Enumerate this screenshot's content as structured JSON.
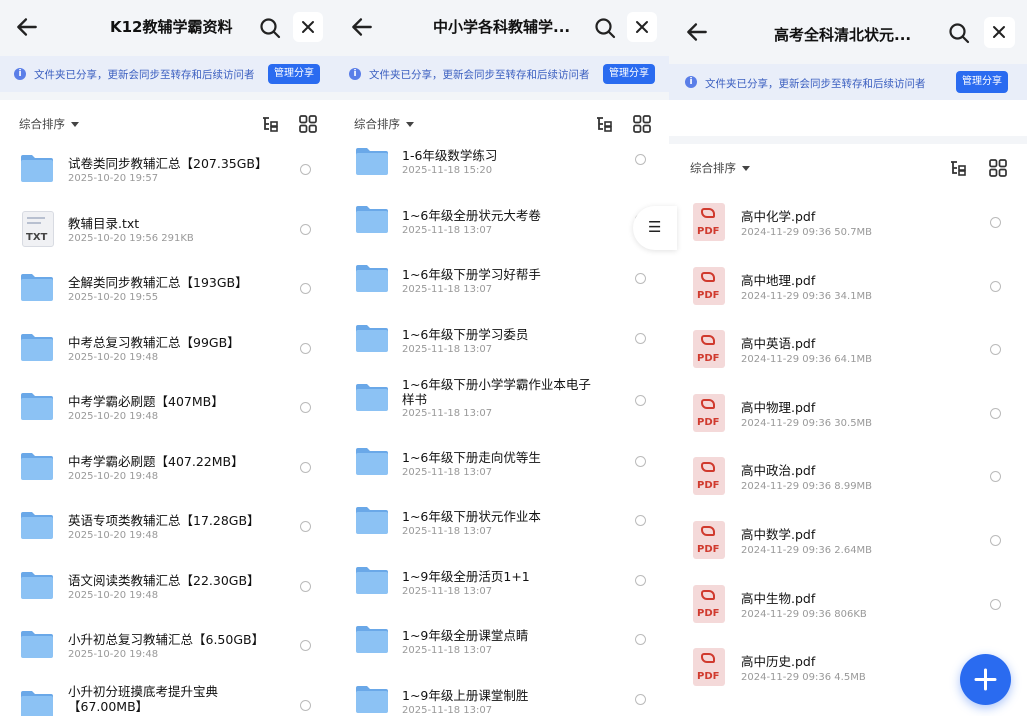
{
  "panel1": {
    "title": "K12教辅学霸资料",
    "banner_text": "文件夹已分享，更新会同步至转存和后续访问者",
    "manage_label": "管理分享",
    "sort_label": "综合排序",
    "items": [
      {
        "type": "folder",
        "name": "试卷类同步教辅汇总【207.35GB】",
        "meta": "2025-10-20 19:57"
      },
      {
        "type": "txt",
        "name": "教辅目录.txt",
        "meta": "2025-10-20 19:56  291KB",
        "icon_label": "TXT"
      },
      {
        "type": "folder",
        "name": "全解类同步教辅汇总【193GB】",
        "meta": "2025-10-20 19:55"
      },
      {
        "type": "folder",
        "name": "中考总复习教辅汇总【99GB】",
        "meta": "2025-10-20 19:48"
      },
      {
        "type": "folder",
        "name": "中考学霸必刷题【407MB】",
        "meta": "2025-10-20 19:48"
      },
      {
        "type": "folder",
        "name": "中考学霸必刷题【407.22MB】",
        "meta": "2025-10-20 19:48"
      },
      {
        "type": "folder",
        "name": "英语专项类教辅汇总【17.28GB】",
        "meta": "2025-10-20 19:48"
      },
      {
        "type": "folder",
        "name": "语文阅读类教辅汇总【22.30GB】",
        "meta": "2025-10-20 19:48"
      },
      {
        "type": "folder",
        "name": "小升初总复习教辅汇总【6.50GB】",
        "meta": "2025-10-20 19:48"
      },
      {
        "type": "folder",
        "name": "小升初分班摸底考提升宝典【67.00MB】",
        "meta": ""
      }
    ]
  },
  "panel2": {
    "title": "中小学各科教辅学...",
    "banner_text": "文件夹已分享，更新会同步至转存和后续访问者",
    "manage_label": "管理分享",
    "sort_label": "综合排序",
    "side_tab_glyph": "☰",
    "items": [
      {
        "name": "1-6年级数学练习",
        "meta": "2025-11-18 15:20"
      },
      {
        "name": "1~6年级全册状元大考卷",
        "meta": "2025-11-18 13:07"
      },
      {
        "name": "1~6年级下册学习好帮手",
        "meta": "2025-11-18 13:07"
      },
      {
        "name": "1~6年级下册学习委员",
        "meta": "2025-11-18 13:07"
      },
      {
        "name": "1~6年级下册小学学霸作业本电子样书",
        "meta": "2025-11-18 13:07"
      },
      {
        "name": "1~6年级下册走向优等生",
        "meta": "2025-11-18 13:07"
      },
      {
        "name": "1~6年级下册状元作业本",
        "meta": "2025-11-18 13:07"
      },
      {
        "name": "1~9年级全册活页1+1",
        "meta": "2025-11-18 13:07"
      },
      {
        "name": "1~9年级全册课堂点睛",
        "meta": "2025-11-18 13:07"
      },
      {
        "name": "1~9年级上册课堂制胜",
        "meta": "2025-11-18 13:07"
      }
    ]
  },
  "panel3": {
    "title": "高考全科清北状元...",
    "banner_text": "文件夹已分享，更新会同步至转存和后续访问者",
    "manage_label": "管理分享",
    "sort_label": "综合排序",
    "items": [
      {
        "name": "高中化学.pdf",
        "meta": "2024-11-29 09:36  50.7MB",
        "icon_label": "PDF"
      },
      {
        "name": "高中地理.pdf",
        "meta": "2024-11-29 09:36  34.1MB",
        "icon_label": "PDF"
      },
      {
        "name": "高中英语.pdf",
        "meta": "2024-11-29 09:36  64.1MB",
        "icon_label": "PDF"
      },
      {
        "name": "高中物理.pdf",
        "meta": "2024-11-29 09:36  30.5MB",
        "icon_label": "PDF"
      },
      {
        "name": "高中政治.pdf",
        "meta": "2024-11-29 09:36  8.99MB",
        "icon_label": "PDF"
      },
      {
        "name": "高中数学.pdf",
        "meta": "2024-11-29 09:36  2.64MB",
        "icon_label": "PDF"
      },
      {
        "name": "高中生物.pdf",
        "meta": "2024-11-29 09:36  806KB",
        "icon_label": "PDF"
      },
      {
        "name": "高中历史.pdf",
        "meta": "2024-11-29 09:36  4.5MB",
        "icon_label": "PDF"
      }
    ]
  },
  "colors": {
    "accent": "#2a6bf0",
    "folder": "#7fb8f0",
    "banner_bg": "#e9eef9",
    "pdf_red": "#d03a2e"
  },
  "icons": [
    "back-arrow-icon",
    "search-icon",
    "close-icon",
    "info-icon",
    "caret-down-icon",
    "tree-view-icon",
    "grid-view-icon",
    "folder-icon",
    "txt-file-icon",
    "pdf-file-icon",
    "plus-icon",
    "menu-icon"
  ]
}
